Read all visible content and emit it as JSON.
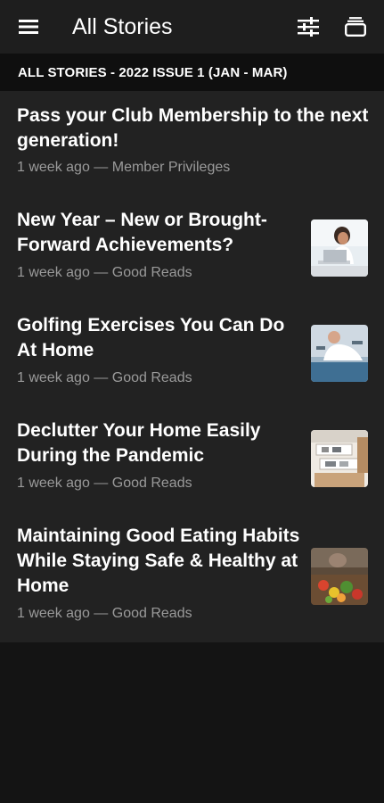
{
  "app_bar": {
    "title": "All Stories",
    "menu_icon": "hamburger-menu-icon",
    "filter_icon": "sliders-filter-icon",
    "saved_icon": "stacked-cards-icon"
  },
  "section": {
    "heading": "ALL STORIES - 2022 ISSUE 1 (JAN - MAR)"
  },
  "stories": [
    {
      "title": "Pass your Club Membership to the next generation!",
      "time": "1 week ago",
      "separator": "—",
      "category": "Member Privileges",
      "thumbnail": ""
    },
    {
      "title": "New Year – New or Brought-Forward Achievements?",
      "time": "1 week ago",
      "separator": "—",
      "category": "Good Reads",
      "thumbnail": "woman-at-laptop-photo"
    },
    {
      "title": "Golfing Exercises You Can Do At Home",
      "time": "1 week ago",
      "separator": "—",
      "category": "Good Reads",
      "thumbnail": "man-exercising-photo"
    },
    {
      "title": "Declutter Your Home Easily During the Pandemic",
      "time": "1 week ago",
      "separator": "—",
      "category": "Good Reads",
      "thumbnail": "storage-drawers-photo"
    },
    {
      "title": "Maintaining Good Eating Habits While Staying Safe & Healthy at Home",
      "time": "1 week ago",
      "separator": "—",
      "category": "Good Reads",
      "thumbnail": "vegetables-kitchen-photo"
    }
  ],
  "colors": {
    "toolbar": "#1e1e1e",
    "section_header": "#0f0f0f",
    "list_background": "#222222",
    "page_background": "#141414",
    "meta_text": "#9a9a9a"
  }
}
